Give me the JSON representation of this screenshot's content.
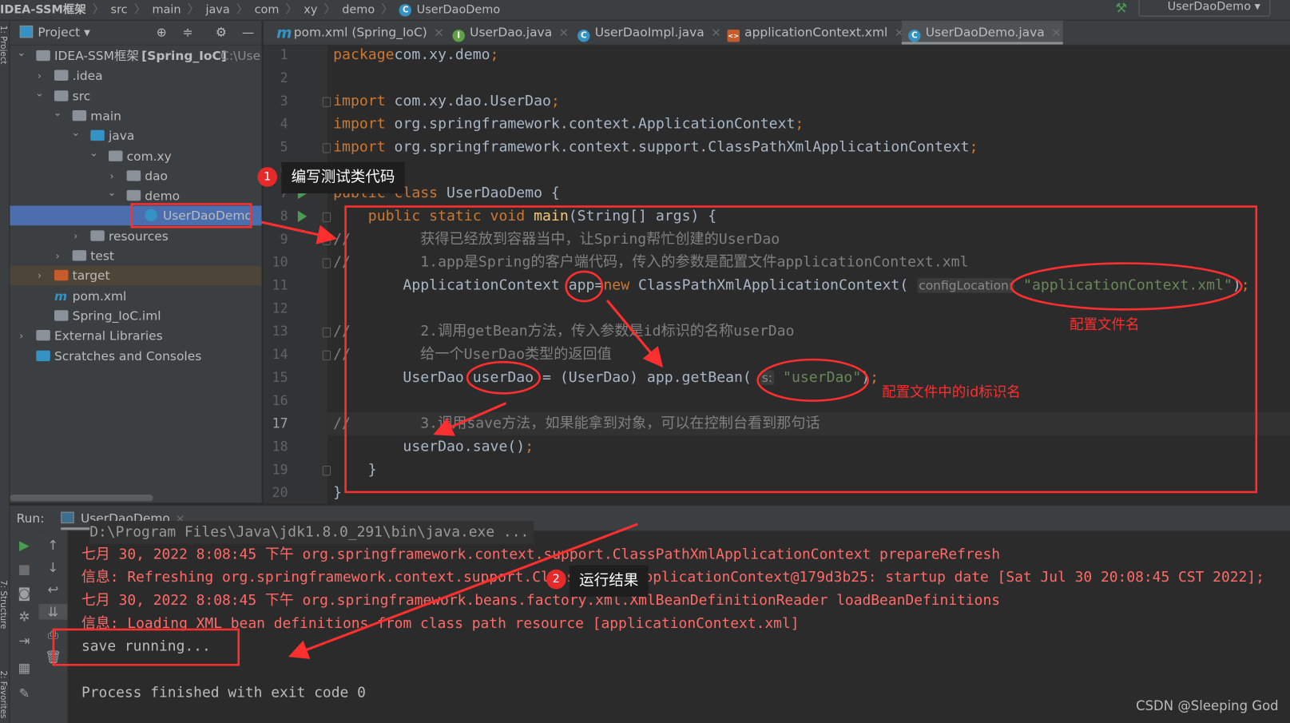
{
  "breadcrumb": [
    "IDEA-SSM框架",
    "src",
    "main",
    "java",
    "com",
    "xy",
    "demo",
    "UserDaoDemo"
  ],
  "run_config": "UserDaoDemo",
  "stripe": {
    "project": "1: Project",
    "structure": "7: Structure",
    "favorites": "2: Favorites"
  },
  "project_panel": {
    "title": "Project",
    "tree": [
      {
        "label": "IDEA-SSM框架",
        "extra": "[Spring_IoC]",
        "path": "C:\\User",
        "depth": 0,
        "arrow": "down",
        "icon": "module"
      },
      {
        "label": ".idea",
        "depth": 1,
        "arrow": "right",
        "icon": "folder"
      },
      {
        "label": "src",
        "depth": 1,
        "arrow": "down",
        "icon": "folder"
      },
      {
        "label": "main",
        "depth": 2,
        "arrow": "down",
        "icon": "folder"
      },
      {
        "label": "java",
        "depth": 3,
        "arrow": "down",
        "icon": "source-folder"
      },
      {
        "label": "com.xy",
        "depth": 4,
        "arrow": "down",
        "icon": "package"
      },
      {
        "label": "dao",
        "depth": 5,
        "arrow": "right",
        "icon": "package"
      },
      {
        "label": "demo",
        "depth": 5,
        "arrow": "down",
        "icon": "package"
      },
      {
        "label": "UserDaoDemo",
        "depth": 6,
        "arrow": "",
        "icon": "class",
        "selected": true
      },
      {
        "label": "resources",
        "depth": 3,
        "arrow": "right",
        "icon": "resources-folder"
      },
      {
        "label": "test",
        "depth": 2,
        "arrow": "right",
        "icon": "folder"
      },
      {
        "label": "target",
        "depth": 1,
        "arrow": "right",
        "icon": "excluded-folder",
        "highlight": true
      },
      {
        "label": "pom.xml",
        "depth": 1,
        "arrow": "",
        "icon": "maven"
      },
      {
        "label": "Spring_IoC.iml",
        "depth": 1,
        "arrow": "",
        "icon": "iml"
      },
      {
        "label": "External Libraries",
        "depth": 0,
        "arrow": "right",
        "icon": "libraries"
      },
      {
        "label": "Scratches and Consoles",
        "depth": 0,
        "arrow": "",
        "icon": "scratches"
      }
    ]
  },
  "tabs": [
    {
      "label": "pom.xml (Spring_IoC)",
      "icon": "maven",
      "active": false
    },
    {
      "label": "UserDao.java",
      "icon": "interface",
      "active": false
    },
    {
      "label": "UserDaoImpl.java",
      "icon": "class",
      "active": false
    },
    {
      "label": "applicationContext.xml",
      "icon": "spring-xml",
      "active": false
    },
    {
      "label": "UserDaoDemo.java",
      "icon": "class",
      "active": true
    }
  ],
  "editor": {
    "current_line": 17,
    "lines": [
      [
        [
          "k",
          "package"
        ],
        [
          "",
          "com.xy.demo"
        ],
        [
          "k",
          ";"
        ]
      ],
      [],
      [
        [
          "k",
          "import"
        ],
        [
          "",
          " com.xy.dao.UserDao"
        ],
        [
          "k",
          ";"
        ]
      ],
      [
        [
          "k",
          "import"
        ],
        [
          "",
          " org.springframework.context.ApplicationContext"
        ],
        [
          "k",
          ";"
        ]
      ],
      [
        [
          "k",
          "import"
        ],
        [
          "",
          " org.springframework.context.support.ClassPathXmlApplicationContext"
        ],
        [
          "k",
          ";"
        ]
      ],
      [],
      [
        [
          "k",
          "public class"
        ],
        [
          "",
          " UserDaoDemo {"
        ]
      ],
      [
        [
          "",
          "    "
        ],
        [
          "k",
          "public static void"
        ],
        [
          "",
          " "
        ],
        [
          "f",
          "main"
        ],
        [
          "",
          "(String[] args) {"
        ]
      ],
      [
        [
          "c",
          "//        获得已经放到容器当中，让Spring帮忙创建的UserDao"
        ]
      ],
      [
        [
          "c",
          "//        1.app是Spring的客户端代码，传入的参数是配置文件applicationContext.xml"
        ]
      ],
      [
        [
          "",
          "        ApplicationContext app="
        ],
        [
          "k",
          "new"
        ],
        [
          "",
          " ClassPathXmlApplicationContext( "
        ],
        [
          "h",
          "configLocation:"
        ],
        [
          "s",
          " \"applicationContext.xml\""
        ],
        [
          "",
          ")"
        ],
        [
          "k",
          ";"
        ]
      ],
      [],
      [
        [
          "c",
          "//        2.调用getBean方法，传入参数是id标识的名称userDao"
        ]
      ],
      [
        [
          "c",
          "//        给一个UserDao类型的返回值"
        ]
      ],
      [
        [
          "",
          "        UserDao userDao = (UserDao) app.getBean( "
        ],
        [
          "h",
          "s:"
        ],
        [
          "s",
          " \"userDao\""
        ],
        [
          "",
          ")"
        ],
        [
          "k",
          ";"
        ]
      ],
      [],
      [
        [
          "c",
          "//        3.调用save方法，如果能拿到对象，可以在控制台看到那句话"
        ]
      ],
      [
        [
          "",
          "        userDao.save()"
        ],
        [
          "k",
          ";"
        ]
      ],
      [
        [
          "",
          "    }"
        ]
      ],
      [
        [
          "",
          "}"
        ]
      ]
    ]
  },
  "run_panel": {
    "label": "Run:",
    "tab": "UserDaoDemo",
    "console": [
      {
        "text": "D:\\Program Files\\Java\\jdk1.8.0_291\\bin\\java.exe ...",
        "style": "cmd"
      },
      {
        "text": "七月 30, 2022 8:08:45 下午 org.springframework.context.support.ClassPathXmlApplicationContext prepareRefresh",
        "style": "red"
      },
      {
        "text": "信息: Refreshing org.springframework.context.support.ClassPathXmlApplicationContext@179d3b25: startup date [Sat Jul 30 20:08:45 CST 2022];",
        "style": "red"
      },
      {
        "text": "七月 30, 2022 8:08:45 下午 org.springframework.beans.factory.xml.XmlBeanDefinitionReader loadBeanDefinitions",
        "style": "red"
      },
      {
        "text": "信息: Loading XML bean definitions from class path resource [applicationContext.xml]",
        "style": "red"
      },
      {
        "text": "save running...",
        "style": "norm"
      },
      {
        "text": "",
        "style": "norm"
      },
      {
        "text": "Process finished with exit code 0",
        "style": "norm"
      }
    ]
  },
  "annotations": {
    "step1_number": "1",
    "step1_label": "编写测试类代码",
    "step2_number": "2",
    "step2_label": "运行结果",
    "config_file_note": "配置文件名",
    "id_note": "配置文件中的id标识名",
    "color": "#ff2f2f"
  },
  "watermark": "CSDN @Sleeping God"
}
